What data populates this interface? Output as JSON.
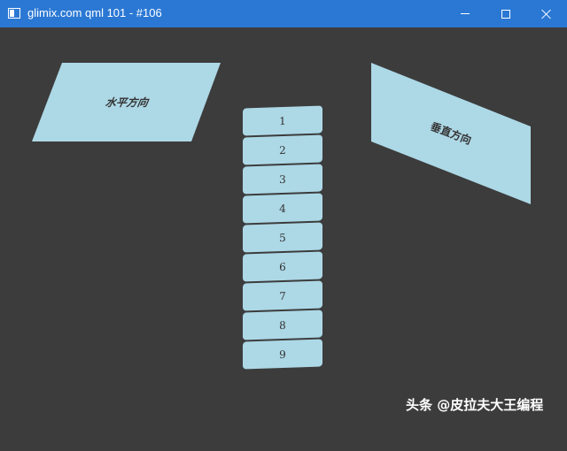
{
  "window": {
    "title": "glimix.com qml 101 - #106",
    "controls": {
      "minimize": "minimize",
      "maximize": "maximize",
      "close": "close"
    }
  },
  "content": {
    "horizontal_label": "水平方向",
    "vertical_label": "垂直方向",
    "list_items": [
      "1",
      "2",
      "3",
      "4",
      "5",
      "6",
      "7",
      "8",
      "9"
    ]
  },
  "watermark": "头条 @皮拉夫大王编程",
  "colors": {
    "titlebar": "#2b78d4",
    "background": "#3c3c3c",
    "shape_fill": "#add8e6",
    "text": "#333333"
  }
}
